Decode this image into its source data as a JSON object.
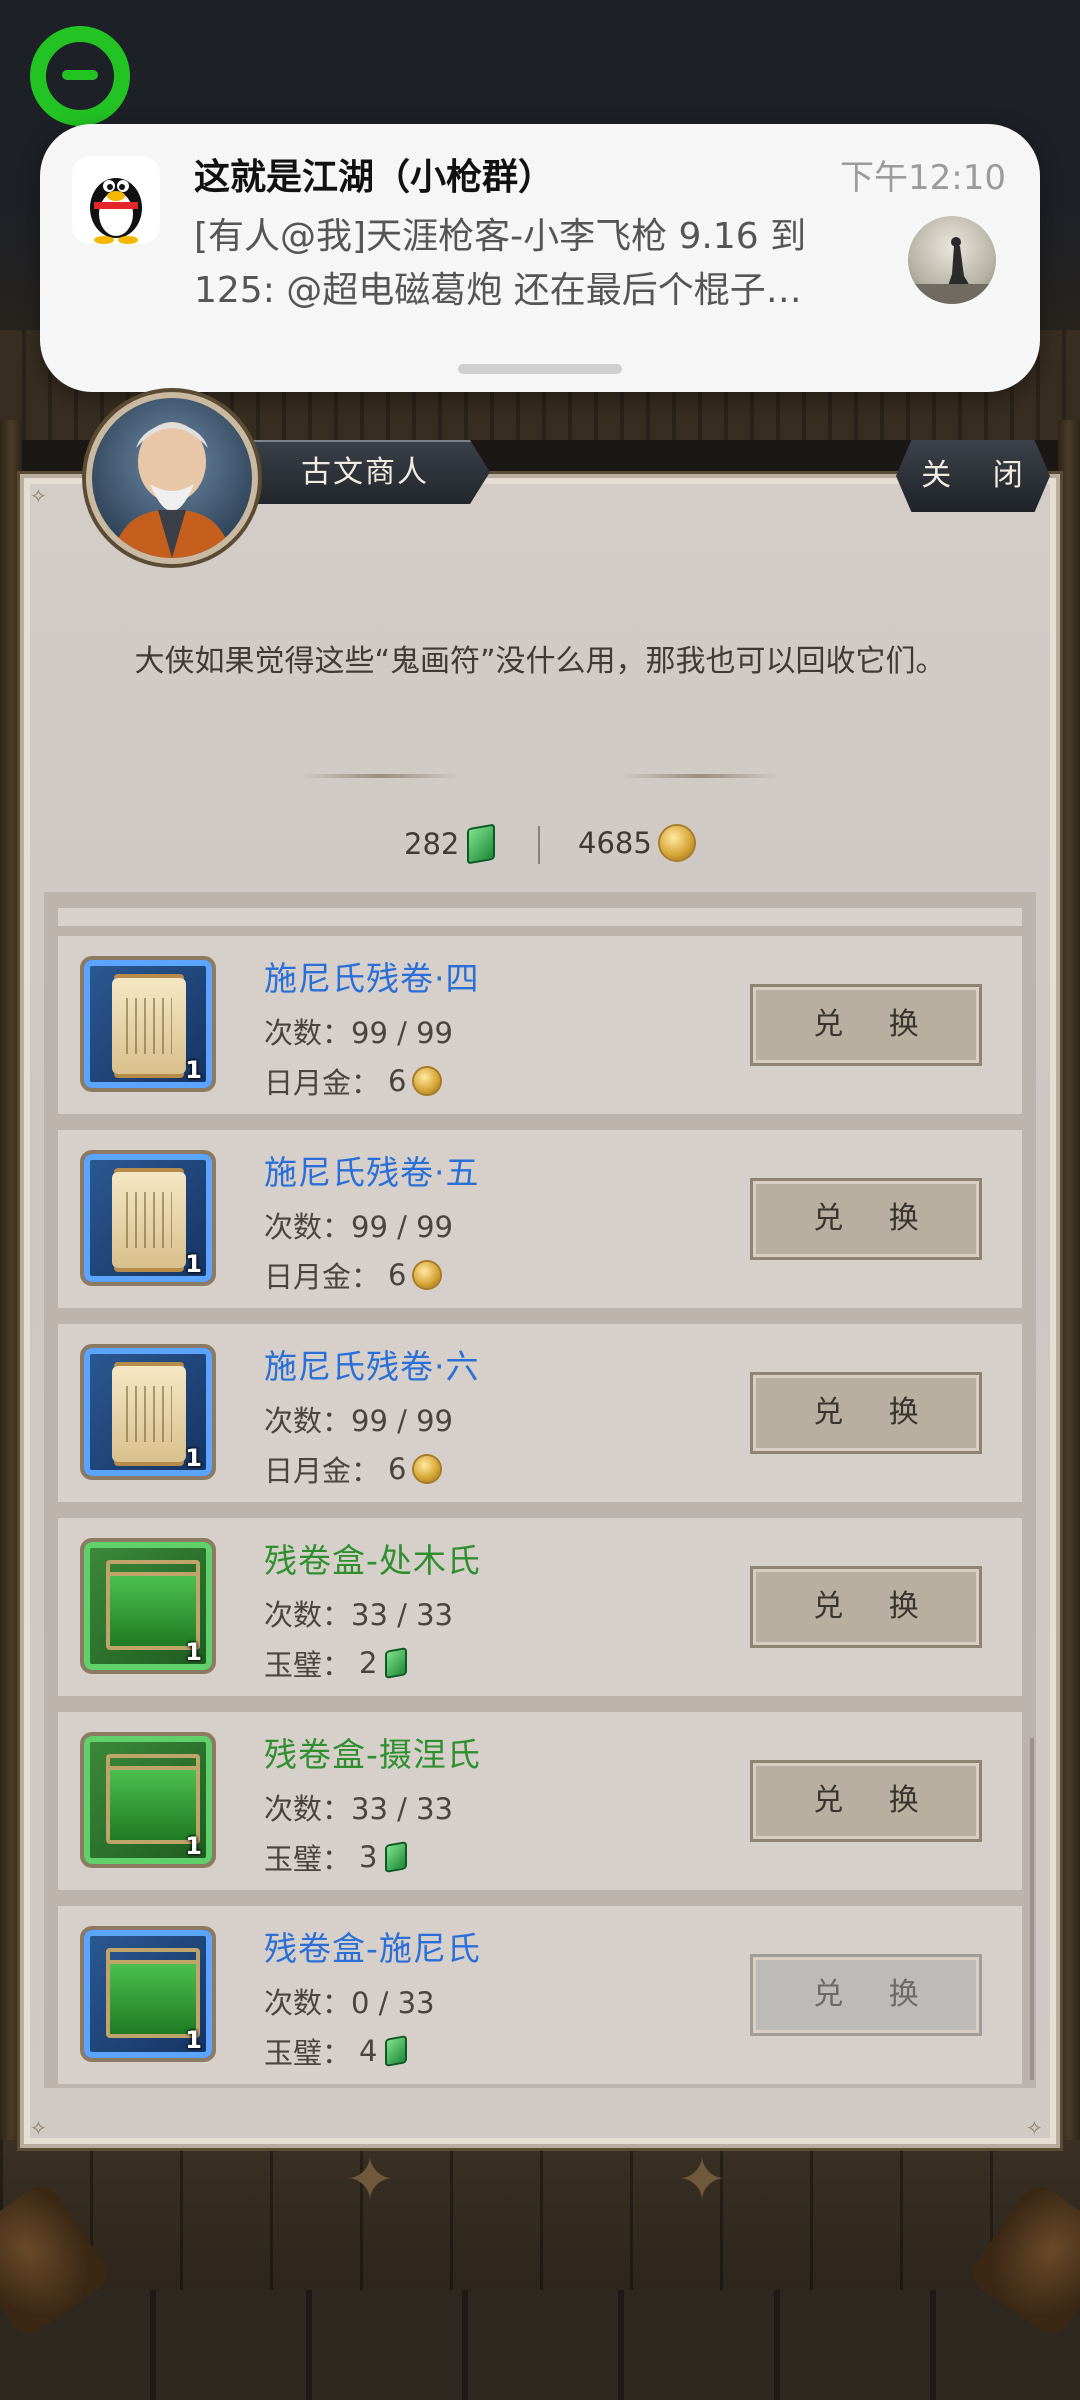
{
  "notification": {
    "app_icon": "qq-penguin-icon",
    "title": "这就是江湖（小枪群）",
    "time": "下午12:10",
    "body_line1": "[有人@我]天涯枪客-小李飞枪 9.16 到",
    "body_line2": "125: @超电磁葛炮 还在最后个棍子…"
  },
  "dialog": {
    "npc_name": "古文商人",
    "close_label": "关 闭",
    "message": "大侠如果觉得这些“鬼画符”没什么用，那我也可以回收它们。"
  },
  "currency": {
    "jade_amount": "282",
    "gold_amount": "4685"
  },
  "items": [
    {
      "name": "施尼氏残卷·四",
      "count": "次数：99 / 99",
      "price_label": "日月金：",
      "price": "6",
      "qty": "1",
      "button": "兑 换",
      "color": "blue",
      "icon": "scroll-icon"
    },
    {
      "name": "施尼氏残卷·五",
      "count": "次数：99 / 99",
      "price_label": "日月金：",
      "price": "6",
      "qty": "1",
      "button": "兑 换",
      "color": "blue",
      "icon": "scroll-icon"
    },
    {
      "name": "施尼氏残卷·六",
      "count": "次数：99 / 99",
      "price_label": "日月金：",
      "price": "6",
      "qty": "1",
      "button": "兑 换",
      "color": "blue",
      "icon": "scroll-icon"
    },
    {
      "name": "残卷盒-处木氏",
      "count": "次数：33 / 33",
      "price_label": "玉璧：",
      "price": "2",
      "qty": "1",
      "button": "兑 换",
      "color": "green",
      "icon": "chest-icon"
    },
    {
      "name": "残卷盒-摄涅氏",
      "count": "次数：33 / 33",
      "price_label": "玉璧：",
      "price": "3",
      "qty": "1",
      "button": "兑 换",
      "color": "green",
      "icon": "chest-icon"
    },
    {
      "name": "残卷盒-施尼氏",
      "count": "次数：0 / 33",
      "price_label": "玉璧：",
      "price": "4",
      "qty": "1",
      "button": "兑 换",
      "color": "blue",
      "icon": "chest-icon"
    }
  ]
}
